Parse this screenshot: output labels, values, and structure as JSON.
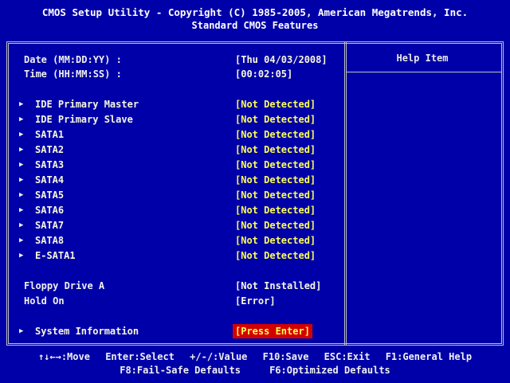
{
  "header": {
    "title": "CMOS Setup Utility - Copyright (C) 1985-2005, American Megatrends, Inc.",
    "subtitle": "Standard CMOS Features"
  },
  "datetime": {
    "date_label": "Date (MM:DD:YY) :",
    "date_value": "[Thu 04/03/2008]",
    "time_label": "Time (HH:MM:SS) :",
    "time_value": "[00:02:05]"
  },
  "drives": [
    {
      "label": "IDE Primary Master",
      "value": "[Not Detected]"
    },
    {
      "label": "IDE Primary Slave",
      "value": "[Not Detected]"
    },
    {
      "label": "SATA1",
      "value": "[Not Detected]"
    },
    {
      "label": "SATA2",
      "value": "[Not Detected]"
    },
    {
      "label": "SATA3",
      "value": "[Not Detected]"
    },
    {
      "label": "SATA4",
      "value": "[Not Detected]"
    },
    {
      "label": "SATA5",
      "value": "[Not Detected]"
    },
    {
      "label": "SATA6",
      "value": "[Not Detected]"
    },
    {
      "label": "SATA7",
      "value": "[Not Detected]"
    },
    {
      "label": "SATA8",
      "value": "[Not Detected]"
    },
    {
      "label": "E-SATA1",
      "value": "[Not Detected]"
    }
  ],
  "floppy": {
    "label": "Floppy Drive A",
    "value": "[Not Installed]"
  },
  "hold_on": {
    "label": "Hold On",
    "value": "[Error]"
  },
  "system_info": {
    "label": "System Information",
    "value": "[Press Enter]"
  },
  "help": {
    "title": "Help Item"
  },
  "footer": {
    "move": "↑↓←→:Move",
    "select": "Enter:Select",
    "value": "+/-/:Value",
    "save": "F10:Save",
    "exit": "ESC:Exit",
    "general_help": "F1:General Help",
    "failsafe": "F8:Fail-Safe Defaults",
    "optimized": "F6:Optimized Defaults"
  },
  "icons": {
    "submenu_arrow": "▶"
  },
  "colors": {
    "background": "#0000a8",
    "highlight": "#d40000",
    "value_text": "#ffff55"
  }
}
